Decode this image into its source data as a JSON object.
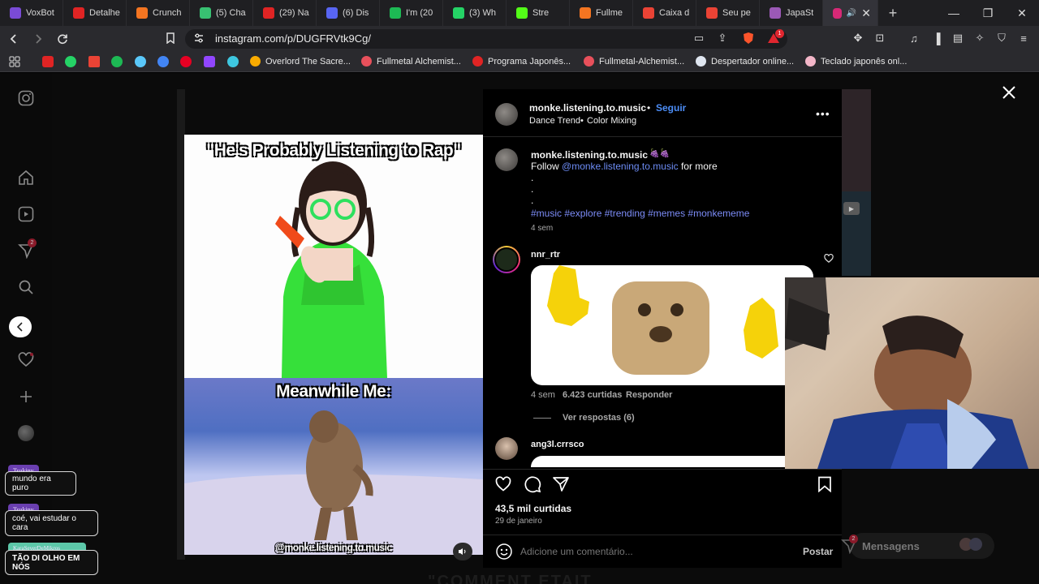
{
  "browser": {
    "tabs": [
      {
        "label": "VoxBot",
        "color": "#7a4bd6"
      },
      {
        "label": "Detalhe",
        "color": "#e02424"
      },
      {
        "label": "Crunch",
        "color": "#f47521"
      },
      {
        "label": "(5) Cha",
        "color": "#38c172"
      },
      {
        "label": "(29) Na",
        "color": "#e02424"
      },
      {
        "label": "(6) Dis",
        "color": "#5865f2"
      },
      {
        "label": "I'm (20",
        "color": "#1db954"
      },
      {
        "label": "(3) Wh",
        "color": "#25d366"
      },
      {
        "label": "Stre",
        "color": "#53fc18"
      },
      {
        "label": "Fullme",
        "color": "#f47521"
      },
      {
        "label": "Caixa d",
        "color": "#ea4335"
      },
      {
        "label": "Seu pe",
        "color": "#ea4335"
      },
      {
        "label": "JapaSt",
        "color": "#9b59b6"
      }
    ],
    "active_tab_color": "#d62976",
    "url": "instagram.com/p/DUGFRVtk9Cg/",
    "shield_badge": "1",
    "bookmarks": [
      {
        "label": "Overlord The Sacre...",
        "color": "#f9ab00"
      },
      {
        "label": "Fullmetal Alchemist...",
        "color": "#e8505b"
      },
      {
        "label": "Programa Japonês...",
        "color": "#e02424"
      },
      {
        "label": "Fullmetal-Alchemist...",
        "color": "#e8505b"
      },
      {
        "label": "Despertador online...",
        "color": "#dfe6f0"
      },
      {
        "label": "Teclado japonês onl...",
        "color": "#f3b6c8"
      }
    ]
  },
  "post": {
    "author": "monke.listening.to.music",
    "follow_label": "Seguir",
    "audio_left": "Dance Trend",
    "audio_right": "Color Mixing",
    "caption_user": "monke.listening.to.music",
    "caption_emoji": "🍇🍇",
    "caption_follow": "Follow",
    "caption_mention": "@monke.listening.to.music",
    "caption_more": "for more",
    "caption_dot": ".",
    "hashtags": "#music #explore #trending #memes #monkememe",
    "caption_age": "4 sem",
    "media": {
      "caption_top": "\"He's Probably Listening to Rap\"",
      "caption_mid": "Meanwhile Me:",
      "watermark": "@monke.listening.to.music"
    },
    "comments": [
      {
        "user": "nnr_rtr",
        "age": "4 sem",
        "likes": "6.423 curtidas",
        "reply": "Responder",
        "view_replies": "Ver respostas (6)"
      },
      {
        "user": "ang3l.crrsco"
      }
    ],
    "likes": "43,5 mil curtidas",
    "date": "29 de janeiro",
    "comment_placeholder": "Adicione um comentário...",
    "post_button": "Postar"
  },
  "sidebar": {
    "notif_count": "2"
  },
  "chat": [
    {
      "name": "Tsukiny",
      "message": "mundo era puro",
      "name_color": "#6a3fb0"
    },
    {
      "name": "Tsukiny",
      "message": "coé, vai estudar o cara",
      "name_color": "#6a3fb0"
    },
    {
      "name": "KaraSeverDeMikros",
      "message": "TÃO DI OLHO EM NÓS",
      "name_color": "#5cc7a8"
    }
  ],
  "messages_pill": {
    "label": "Mensagens",
    "badge": "2"
  },
  "bottom_text": "\"COMMENT ETAIT"
}
